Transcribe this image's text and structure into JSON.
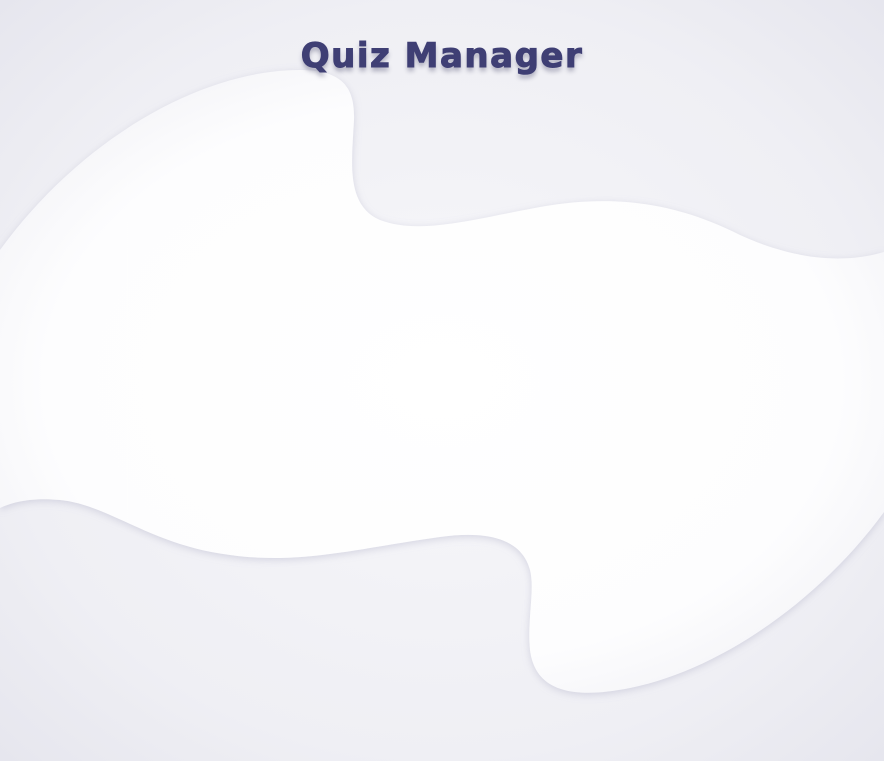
{
  "header": {
    "title": "Quiz Manager"
  },
  "colors": {
    "title": "#3f3f74",
    "background": "#efeff4",
    "panel": "#ffffff"
  }
}
